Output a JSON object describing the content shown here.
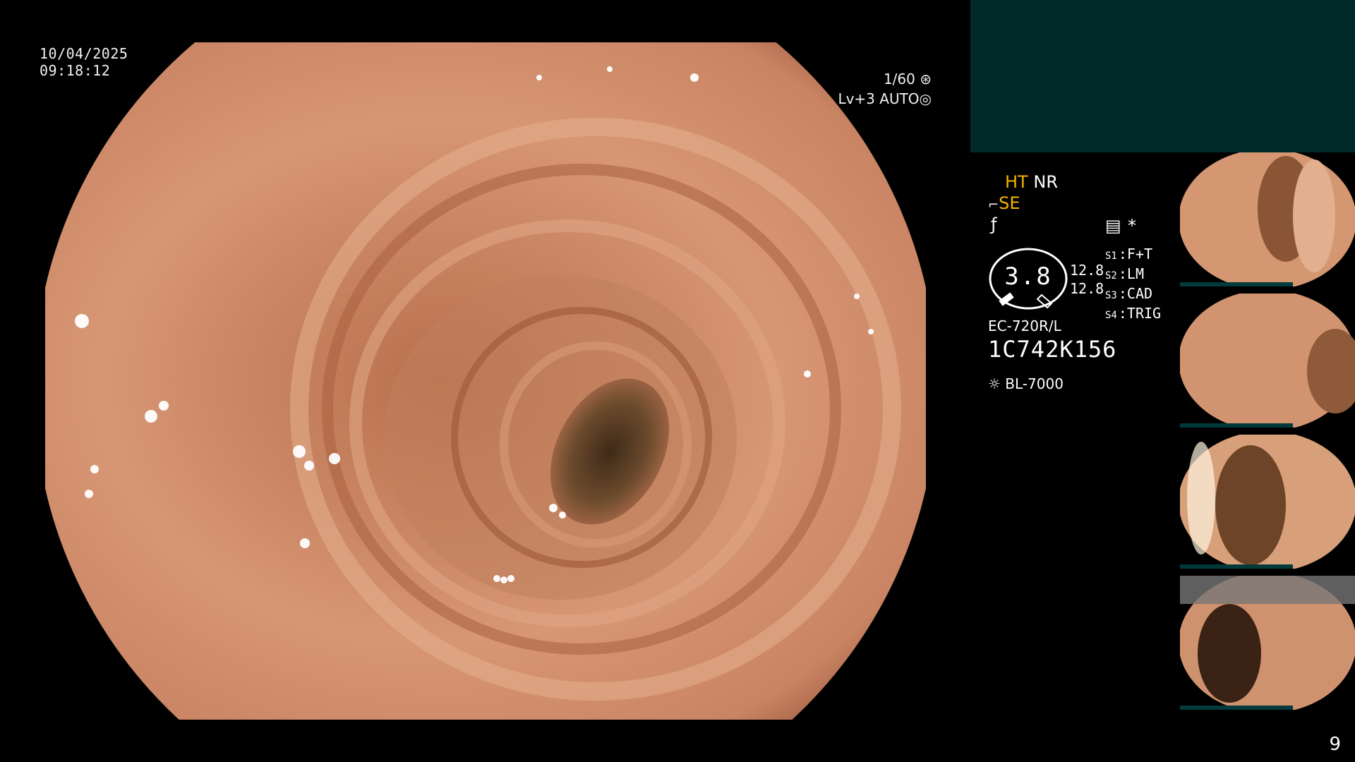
{
  "overlay": {
    "date": "10/04/2025",
    "time": "09:18:12",
    "shutter": "1/60",
    "level": "Lv+3",
    "iris_mode": "AUTO"
  },
  "settings": {
    "ht": "HT",
    "nr": "NR",
    "se": "SE",
    "gauge_value": "3.8",
    "value_1": "12.8",
    "value_2": "12.8",
    "s_list": [
      {
        "key": "S1",
        "value": "F+T"
      },
      {
        "key": "S2",
        "value": "LM"
      },
      {
        "key": "S3",
        "value": "CAD"
      },
      {
        "key": "S4",
        "value": "TRIG"
      }
    ],
    "asterisk": "*",
    "scope_model": "EC-720R/L",
    "serial": "1C742K156",
    "light_source": "BL-7000"
  },
  "colors": {
    "mucosa": "#c98a66",
    "mucosa_dark": "#8e5236",
    "lumen": "#4a3420",
    "status_panel": "#002a2a",
    "accent_yellow": "#f3b400"
  },
  "thumbnails": [
    {
      "name": "thumbnail-1"
    },
    {
      "name": "thumbnail-2"
    },
    {
      "name": "thumbnail-3"
    },
    {
      "name": "thumbnail-4"
    }
  ],
  "page_number": "9"
}
